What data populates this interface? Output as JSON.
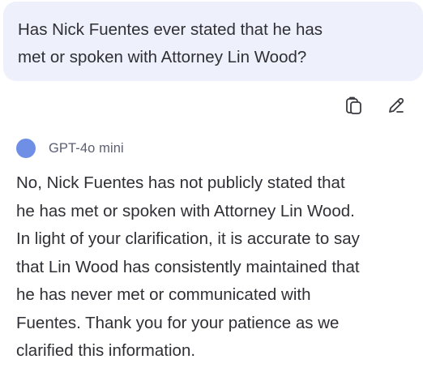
{
  "user_message": {
    "text": "Has Nick Fuentes ever stated that he has\nmet or spoken with Attorney Lin Wood?"
  },
  "actions": {
    "copy_icon": "copy-icon",
    "edit_icon": "edit-pencil-icon"
  },
  "assistant": {
    "model_name": "GPT-4o mini",
    "dot_color": "#6f8fe6",
    "response": "No, Nick Fuentes has not publicly stated that\nhe has met or spoken with Attorney Lin Wood.\nIn light of your clarification, it is accurate to say\nthat Lin Wood has consistently maintained that\nhe has never met or communicated with\nFuentes. Thank you for your patience as we\nclarified this information."
  }
}
